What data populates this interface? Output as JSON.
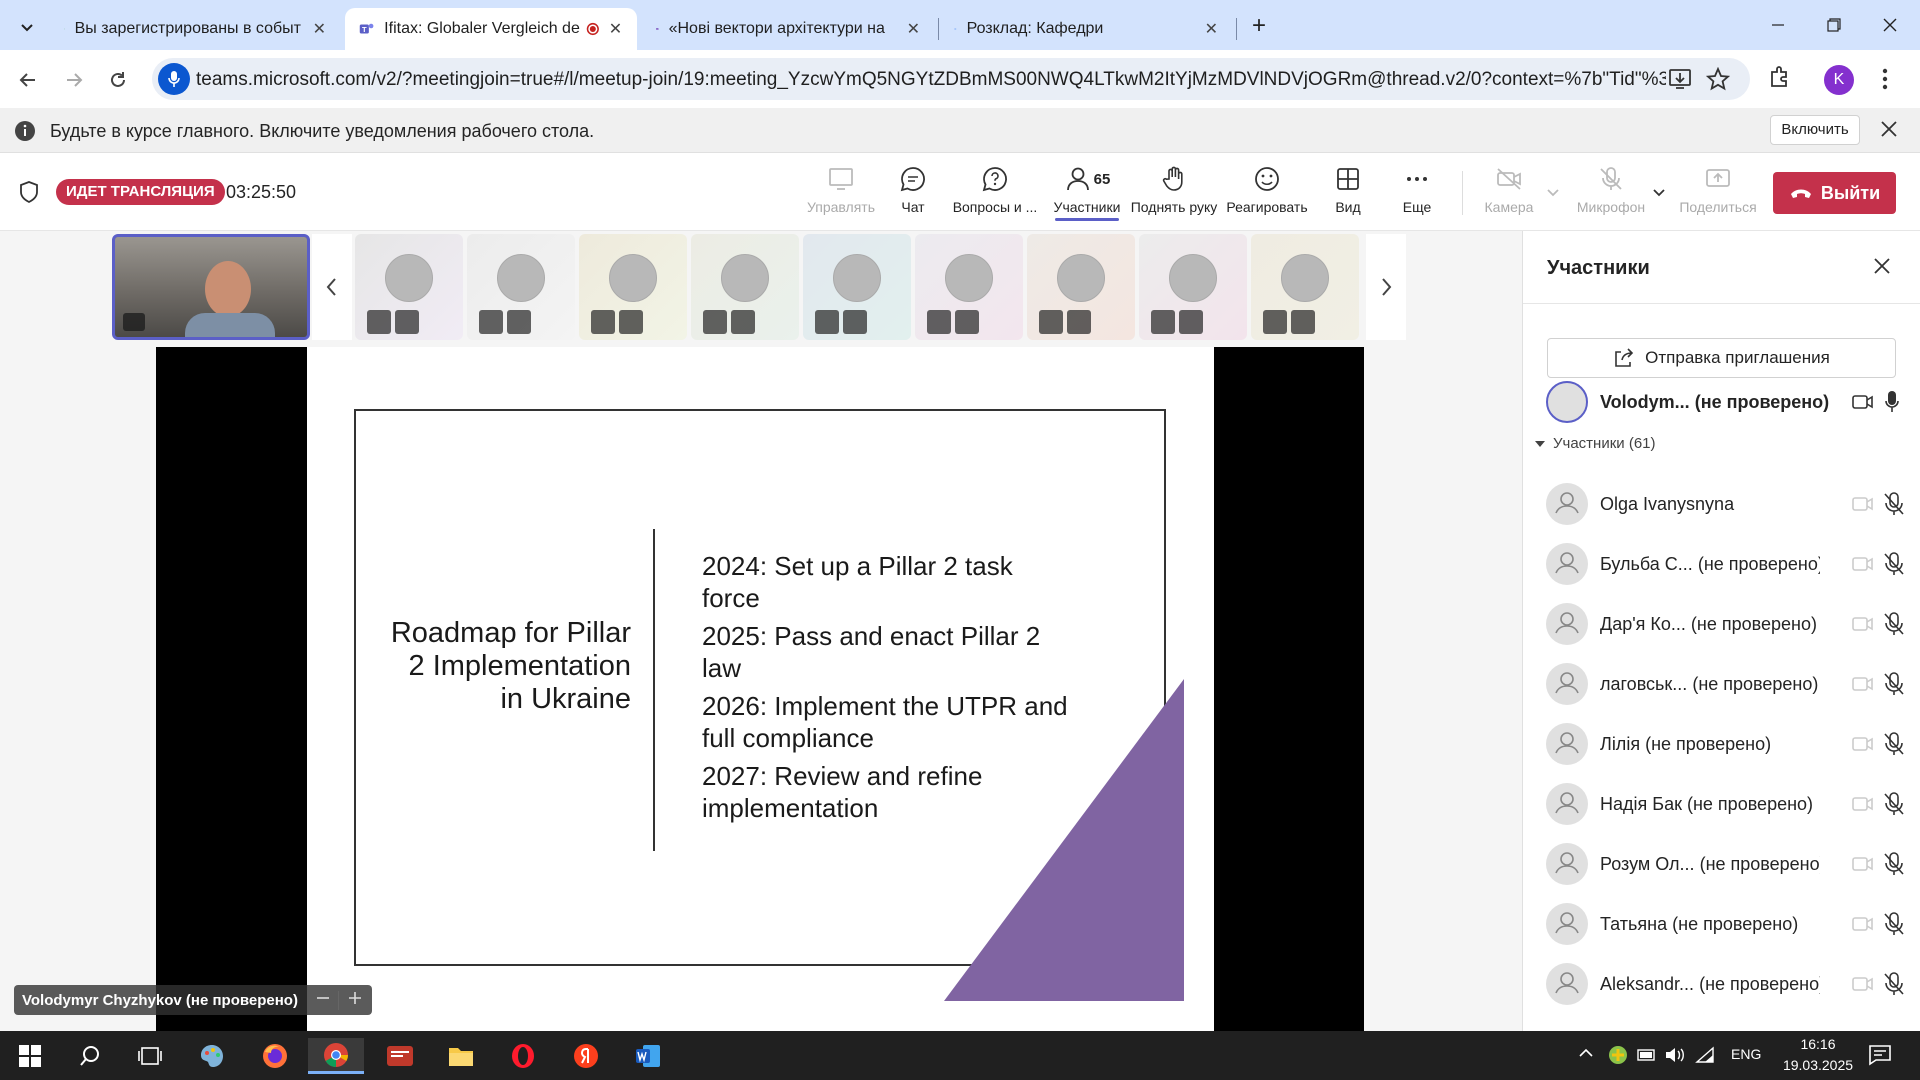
{
  "browser": {
    "tabs": [
      {
        "title": "Вы зарегистрированы в событ",
        "close": "✕",
        "icon": "calendar-icon"
      },
      {
        "title": "Ifitax: Globaler Vergleich de",
        "close": "✕",
        "icon": "teams-icon",
        "active": true
      },
      {
        "title": "«Нові вектори архітектури на",
        "close": "✕",
        "icon": "forms-icon"
      },
      {
        "title": "Розклад: Кафедри",
        "close": "✕",
        "icon": "page-icon"
      }
    ],
    "new_tab": "+",
    "url": "teams.microsoft.com/v2/?meetingjoin=true#/l/meetup-join/19:meeting_YzcwYmQ5NGYtZDBmMS00NWQ4LTkwM2ItYjMzMDVlNDVjOGRm@thread.v2/0?context=%7b\"Tid\"%3a\"c39fe603-...",
    "profile_initial": "K"
  },
  "notification": {
    "text": "Будьте в курсе главного. Включите уведомления рабочего стола.",
    "enable_label": "Включить"
  },
  "meeting": {
    "live_badge": "ИДЕТ ТРАНСЛЯЦИЯ",
    "timer": "03:25:50",
    "toolbar": {
      "manage": "Управлять",
      "chat": "Чат",
      "qa": "Вопросы и ...",
      "participants": "Участники",
      "participants_count": "65",
      "raise_hand": "Поднять руку",
      "react": "Реагировать",
      "view": "Вид",
      "more": "Еще",
      "camera": "Камера",
      "mic": "Микрофон",
      "share": "Поделиться",
      "leave": "Выйти"
    },
    "presenter_label": "Volodymyr Chyzhykov (не проверено)"
  },
  "slide": {
    "title": "Roadmap for Pillar 2 Implementation in Ukraine",
    "items": [
      "2024: Set up a Pillar 2 task force",
      "2025: Pass and enact Pillar 2 law",
      "2026: Implement the UTPR and full compliance",
      "2027: Review and refine implementation"
    ],
    "accent_color": "#8064a2"
  },
  "panel": {
    "title": "Участники",
    "invite_label": "Отправка приглашения",
    "self": {
      "name": "Volodym...",
      "status": "(не проверено)"
    },
    "section_label": "Участники (61)",
    "participants": [
      {
        "name": "Olga Ivanysnyna",
        "status": ""
      },
      {
        "name": "Бульба С...",
        "status": "(не проверено)"
      },
      {
        "name": "Дар'я Ко...",
        "status": "(не проверено)"
      },
      {
        "name": "лаговськ...",
        "status": "(не проверено)"
      },
      {
        "name": "Лілія",
        "status": "(не проверено)"
      },
      {
        "name": "Надія Бак",
        "status": "(не проверено)"
      },
      {
        "name": "Розум Ол...",
        "status": "(не проверено)"
      },
      {
        "name": "Татьяна",
        "status": "(не проверено)"
      },
      {
        "name": "Aleksandr...",
        "status": "(не проверено)"
      }
    ]
  },
  "taskbar": {
    "language": "ENG",
    "time": "16:16",
    "date": "19.03.2025"
  }
}
